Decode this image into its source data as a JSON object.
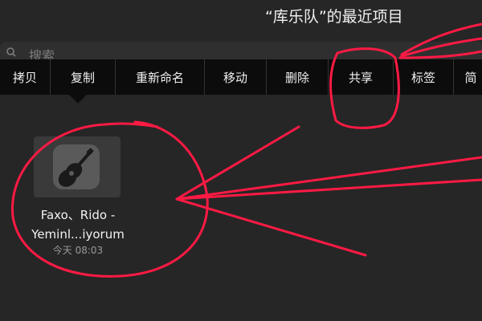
{
  "header": {
    "title": "“库乐队”的最近项目"
  },
  "search": {
    "placeholder": "搜索"
  },
  "context_menu": {
    "items": [
      {
        "label": "拷贝"
      },
      {
        "label": "复制"
      },
      {
        "label": "重新命名"
      },
      {
        "label": "移动"
      },
      {
        "label": "删除"
      },
      {
        "label": "共享"
      },
      {
        "label": "标签"
      },
      {
        "label": "简"
      }
    ]
  },
  "file": {
    "name": "Faxo、Rido - Yeminl...iyorum",
    "date": "今天 08:03",
    "icon": "guitar-icon"
  },
  "annotation_color": "#ff1a44"
}
